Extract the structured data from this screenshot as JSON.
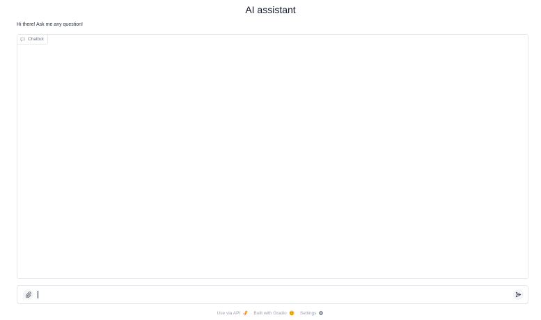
{
  "header": {
    "title": "AI assistant",
    "description": "Hi there! Ask me any question!"
  },
  "chatbot": {
    "label": "Chatbot",
    "messages": []
  },
  "composer": {
    "value": "",
    "placeholder": ""
  },
  "footer": {
    "api_label": "Use via API",
    "built_label": "Built with Gradio",
    "settings_label": "Settings",
    "separator": "·"
  },
  "colors": {
    "border": "#e5e7eb",
    "muted_text": "#9ca3af",
    "button_bg": "#f3f4f6"
  }
}
